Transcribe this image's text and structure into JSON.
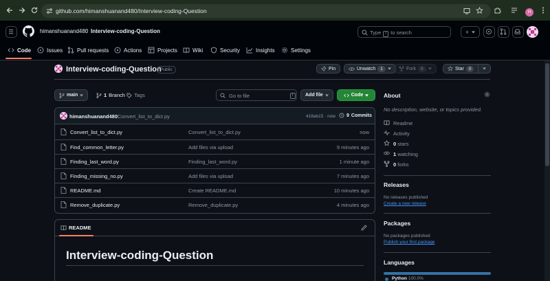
{
  "browser": {
    "url": "github.com/himanshuanand480/Interview-coding-Question",
    "profile_initial": "H"
  },
  "header": {
    "owner": "himanshuanand480",
    "separator": "/",
    "repo": "Interview-coding-Question",
    "search_pre": "Type",
    "search_key": "/",
    "search_post": "to search",
    "create_label": "+"
  },
  "tabs": [
    {
      "label": "Code"
    },
    {
      "label": "Issues"
    },
    {
      "label": "Pull requests"
    },
    {
      "label": "Actions"
    },
    {
      "label": "Projects"
    },
    {
      "label": "Wiki"
    },
    {
      "label": "Security"
    },
    {
      "label": "Insights"
    },
    {
      "label": "Settings"
    }
  ],
  "repo": {
    "name": "Interview-coding-Question",
    "visibility": "Public",
    "pin_label": "Pin",
    "unwatch_label": "Unwatch",
    "watch_count": "1",
    "fork_label": "Fork",
    "fork_count": "0",
    "star_label": "Star",
    "star_count": "0"
  },
  "toolbar": {
    "branch": "main",
    "branch_count": "1",
    "branch_label": "Branch",
    "tags_label": "Tags",
    "go_to_file": "Go to file",
    "go_to_file_key": "t",
    "add_file": "Add file",
    "code_button": "Code"
  },
  "commit": {
    "author": "himanshuanand480",
    "message": "Convert_list_to_dict.py",
    "hash_time": "418ab15 · now",
    "commits_count": "9",
    "commits_label": "Commits"
  },
  "files": [
    {
      "name": "Convert_list_to_dict.py",
      "message": "Convert_list_to_dict.py",
      "time": "now"
    },
    {
      "name": "Find_common_letter.py",
      "message": "Add files via upload",
      "time": "9 minutes ago"
    },
    {
      "name": "Finding_last_word.py",
      "message": "Finding_last_word.py",
      "time": "1 minute ago"
    },
    {
      "name": "Finding_missing_no.py",
      "message": "Add files via upload",
      "time": "7 minutes ago"
    },
    {
      "name": "README.md",
      "message": "Create README.md",
      "time": "10 minutes ago"
    },
    {
      "name": "Remove_duplicate.py",
      "message": "Remove_duplicate.py",
      "time": "4 minutes ago"
    }
  ],
  "readme": {
    "tab_label": "README",
    "title": "Interview-coding-Question"
  },
  "about": {
    "heading": "About",
    "description": "No description, website, or topics provided.",
    "readme_label": "Readme",
    "activity_label": "Activity",
    "stars_count": "0",
    "stars_label": "stars",
    "watching_count": "1",
    "watching_label": "watching",
    "forks_count": "0",
    "forks_label": "forks"
  },
  "releases": {
    "heading": "Releases",
    "empty": "No releases published",
    "create_link": "Create a new release"
  },
  "packages": {
    "heading": "Packages",
    "empty": "No packages published",
    "publish_link": "Publish your first package"
  },
  "languages": {
    "heading": "Languages",
    "items": [
      {
        "name": "Python",
        "percent": "100.0%",
        "fraction": 1.0,
        "color": "#3572A5"
      }
    ]
  },
  "colors": {
    "accent_green": "#238636",
    "link_blue": "#4493f8",
    "tab_underline": "#f78166"
  }
}
